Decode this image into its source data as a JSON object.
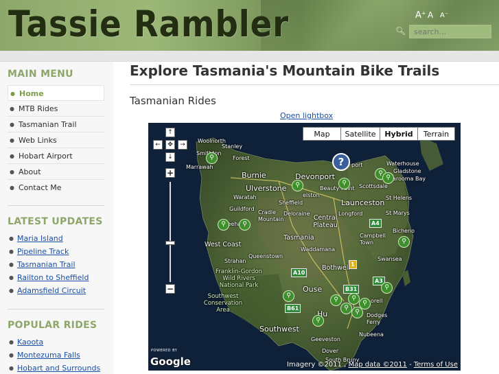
{
  "header": {
    "logo": "Tassie Rambler",
    "font_increase": "A⁺",
    "font_reset": "A",
    "font_decrease": "A⁻",
    "search_placeholder": "search..."
  },
  "sidebar": {
    "main_menu_heading": "MAIN MENU",
    "menu": [
      {
        "label": "Home",
        "active": true
      },
      {
        "label": "MTB Rides"
      },
      {
        "label": "Tasmanian Trail"
      },
      {
        "label": "Web Links"
      },
      {
        "label": "Hobart Airport"
      },
      {
        "label": "About"
      },
      {
        "label": "Contact Me"
      }
    ],
    "latest_heading": "LATEST UPDATES",
    "latest": [
      "Maria Island",
      "Pipeline Track",
      "Tasmanian Trail",
      "Railton to Sheffield",
      "Adamsfield Circuit"
    ],
    "popular_heading": "POPULAR RIDES",
    "popular": [
      "Kaoota",
      "Montezuma Falls",
      "Hobart and Surrounds"
    ]
  },
  "main": {
    "title": "Explore Tasmania's Mountain Bike Trails",
    "subtitle": "Tasmanian Rides",
    "lightbox_link": "Open lightbox"
  },
  "map": {
    "types": [
      "Map",
      "Satellite",
      "Hybrid",
      "Terrain"
    ],
    "selected_type": "Hybrid",
    "help_glyph": "?",
    "powered_by": "POWERED BY",
    "google": "Google",
    "attribution": {
      "imagery": "Imagery ©2011 ,",
      "map_data": "Map data ©2011",
      "terms": "Terms of Use",
      "separator": " - "
    },
    "places": {
      "woolnorth": "Woolnorth",
      "stanley": "Stanley",
      "smithton": "Smithton",
      "forest": "Forest",
      "marrawah": "Marrawah",
      "burnie": "Burnie",
      "devonport": "Devonport",
      "port": "port",
      "waterhouse": "Waterhouse",
      "gladstone": "Gladstone",
      "ringarooma_bay": "Ringarooma Bay",
      "ulverstone": "Ulverstone",
      "beauty_point": "Beauty Point",
      "scottsdale": "Scottsdale",
      "waratah": "Waratah",
      "sheffield": "Sheffield",
      "elston": "elston",
      "launceston": "Launceston",
      "st_helens": "St Helens",
      "guildford": "Guildford",
      "cradle_mountain": "Cradle Mountain",
      "deloraine": "Deloraine",
      "longford": "Longford",
      "st_marys": "St Marys",
      "zeehan": "Zeehan",
      "central_plateau": "Central Plateau",
      "campbell_town": "Campbell Town",
      "bicheno": "Bicheno",
      "tasmania": "Tasmania",
      "west_coast": "West Coast",
      "waddamana": "Waddamana",
      "queenstown": "Queenstown",
      "swansea": "Swansea",
      "strahan": "Strahan",
      "bothwell": "Bothwell",
      "franklin_gordon": "Franklin-Gordon Wild Rivers National Park",
      "ouse": "Ouse",
      "southwest_cons": "Southwest Conservation Area",
      "sorell": "orell",
      "hobart": "Hu",
      "dodges_ferry": "Dodges Ferry",
      "southwest": "Southwest",
      "nubeena": "Nubeena",
      "geeveston": "Geeveston",
      "dover": "Dover",
      "south_bruny": "South Bruny"
    },
    "roads": [
      "A4",
      "A10",
      "B31",
      "A3",
      "B61",
      "1"
    ]
  }
}
